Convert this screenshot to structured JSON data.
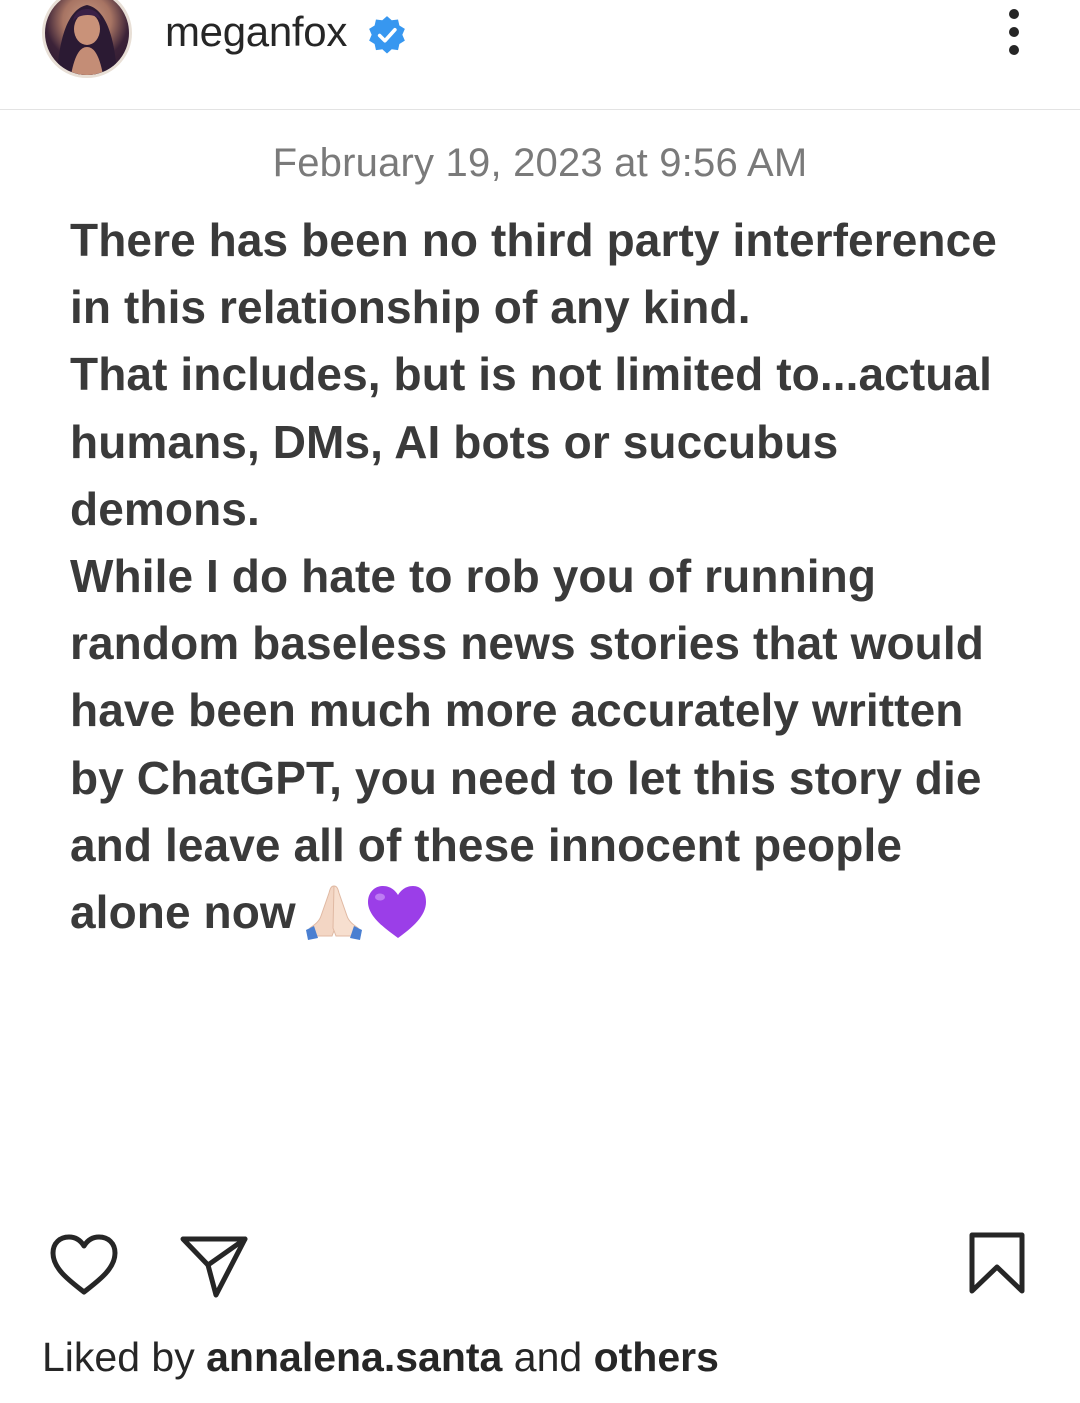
{
  "header": {
    "username": "meganfox",
    "verified_icon": "verified-badge-icon",
    "more_icon": "more-options-icon"
  },
  "post": {
    "timestamp": "February 19, 2023 at 9:56 AM",
    "lines": [
      "There has been no third party interference",
      "in this relationship of any kind.",
      "That includes, but is not limited to...actual",
      "humans, DMs, AI bots or succubus",
      "demons.",
      "While I do hate to rob you of running",
      "random baseless news stories that would",
      "have been much more accurately written",
      "by ChatGPT, you need to let this story die",
      "and leave all of these innocent people",
      "alone now"
    ],
    "trailing_emojis": [
      "folded-hands-emoji",
      "purple-heart-emoji"
    ]
  },
  "actions": {
    "like_icon": "heart-icon",
    "share_icon": "send-icon",
    "save_icon": "bookmark-icon"
  },
  "likes": {
    "prefix": "Liked by",
    "user": "annalena.santa",
    "connector": "and",
    "others": "others"
  },
  "colors": {
    "text_primary": "#262626",
    "text_body": "#3a3a3a",
    "timestamp": "#7a7a7a",
    "verified_blue": "#3797f0",
    "divider": "#e3e3e3",
    "purple_heart": "#9b3ee8"
  }
}
